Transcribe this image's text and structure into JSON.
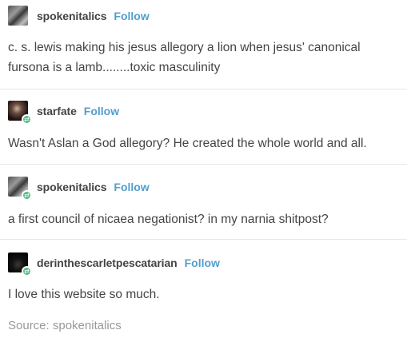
{
  "posts": [
    {
      "username": "spokenitalics",
      "follow_label": "Follow",
      "text": "c. s. lewis making his jesus allegory a lion when jesus' canonical fursona is a lamb........toxic masculinity"
    },
    {
      "username": "starfate",
      "follow_label": "Follow",
      "text": "Wasn't Aslan a God allegory? He created the whole world and all."
    },
    {
      "username": "spokenitalics",
      "follow_label": "Follow",
      "text": "a first council of nicaea negationist? in my narnia shitpost?"
    },
    {
      "username": "derinthescarletpescatarian",
      "follow_label": "Follow",
      "text": "I love this website so much."
    }
  ],
  "source": {
    "text": "Source: spokenitalics"
  },
  "colors": {
    "link_blue": "#529ecc",
    "text": "#444444",
    "muted": "#999999",
    "reblog_green": "#56bc8a"
  },
  "icons": {
    "reblog_badge": "reblog-icon"
  }
}
